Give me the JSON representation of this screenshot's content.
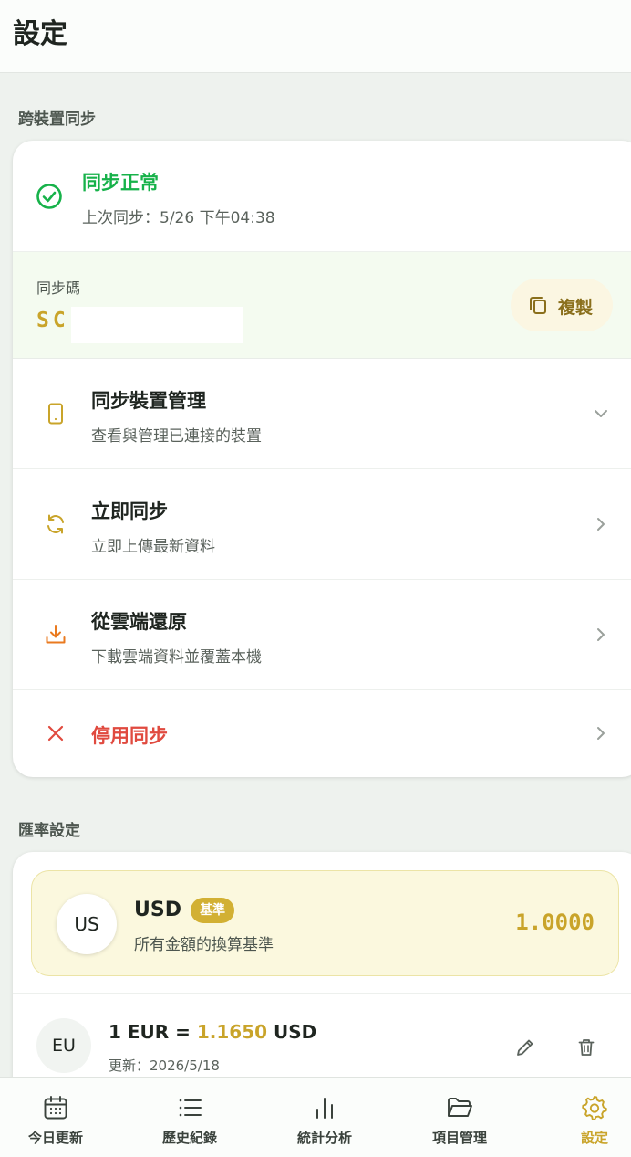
{
  "header": {
    "title": "設定"
  },
  "sync_section": {
    "label": "跨裝置同步",
    "status": {
      "title": "同步正常",
      "subtitle": "上次同步：5/26 下午04:38"
    },
    "code": {
      "label": "同步碼",
      "value": "SC",
      "copy_label": "複製"
    },
    "items": [
      {
        "title": "同步裝置管理",
        "subtitle": "查看與管理已連接的裝置",
        "icon": "phone-icon"
      },
      {
        "title": "立即同步",
        "subtitle": "立即上傳最新資料",
        "icon": "refresh-icon"
      },
      {
        "title": "從雲端還原",
        "subtitle": "下載雲端資料並覆蓋本機",
        "icon": "download-icon"
      },
      {
        "title": "停用同步",
        "icon": "close-icon"
      }
    ]
  },
  "rate_section": {
    "label": "匯率設定",
    "base": {
      "avatar": "US",
      "code": "USD",
      "badge": "基準",
      "subtitle": "所有金額的換算基準",
      "rate": "1.0000"
    },
    "rates": [
      {
        "avatar": "EU",
        "prefix": "1 EUR = ",
        "value": "1.1650",
        "suffix": " USD",
        "updated": "更新：2026/5/18"
      }
    ]
  },
  "tabs": [
    {
      "label": "今日更新",
      "icon": "calendar-icon"
    },
    {
      "label": "歷史紀錄",
      "icon": "list-icon"
    },
    {
      "label": "統計分析",
      "icon": "bar-chart-icon"
    },
    {
      "label": "項目管理",
      "icon": "folder-icon"
    },
    {
      "label": "設定",
      "icon": "gear-icon",
      "active": true
    }
  ],
  "colors": {
    "accent": "#c9a42a",
    "success": "#17b24a",
    "danger": "#e04a3f",
    "download": "#ea7a1f"
  }
}
